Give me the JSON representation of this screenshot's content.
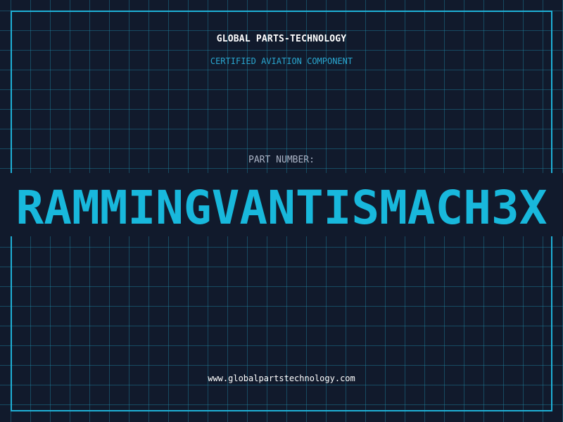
{
  "header": {
    "company": "GLOBAL PARTS-TECHNOLOGY",
    "subtitle": "CERTIFIED AVIATION COMPONENT"
  },
  "part": {
    "label": "PART NUMBER:",
    "number": "RAMMINGVANTISMACH3X"
  },
  "footer": {
    "url": "www.globalpartstechnology.com"
  },
  "colors": {
    "background": "#111a2c",
    "grid": "#1f8caa",
    "frame": "#1fb0d6",
    "accent": "#18b8dc",
    "label": "#a9b2c4",
    "text": "#ffffff"
  }
}
